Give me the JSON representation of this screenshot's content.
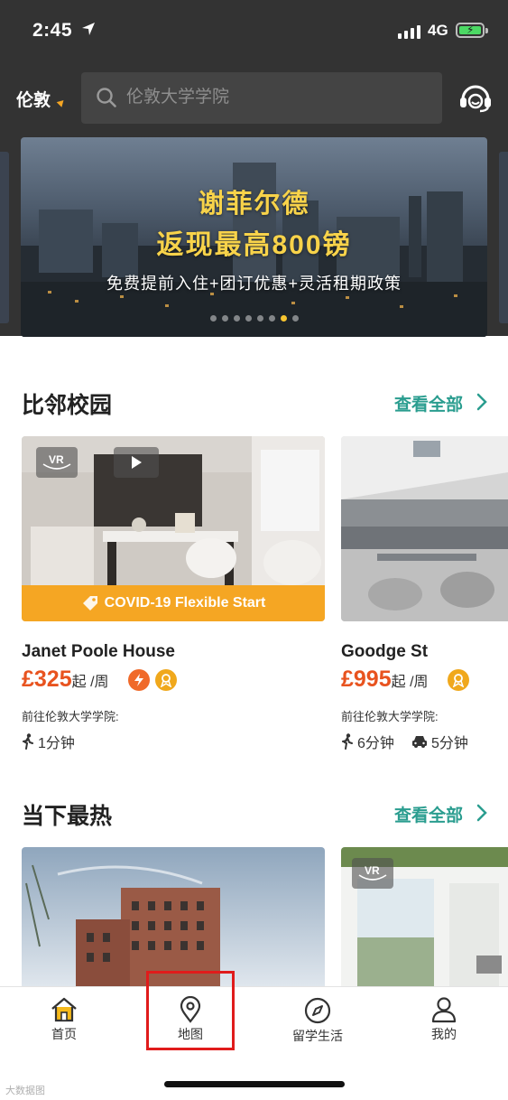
{
  "status_bar": {
    "time": "2:45",
    "network": "4G",
    "battery_level": 0.85
  },
  "header": {
    "city": "伦敦",
    "search": {
      "placeholder": "伦敦大学学院",
      "value": ""
    },
    "support_icon": "headset-icon"
  },
  "banner": {
    "title_line1": "谢菲尔德",
    "title_line2": "返现最高800镑",
    "subtitle": "免费提前入住+团订优惠+灵活租期政策",
    "page_count": 8,
    "active_page": 6
  },
  "nearby_section": {
    "title": "比邻校园",
    "see_all": "查看全部",
    "cards": [
      {
        "name": "Janet Poole House",
        "price": "£325",
        "price_suffix": "起 /周",
        "banner": "COVID-19 Flexible Start",
        "tags": [
          "VR",
          "video"
        ],
        "badges": [
          "flash-icon",
          "award-icon"
        ],
        "destination": "前往伦敦大学学院:",
        "walk": "1分钟"
      },
      {
        "name": "Goodge St",
        "price": "£995",
        "price_suffix": "起 /周",
        "badges": [
          "award-icon"
        ],
        "destination": "前往伦敦大学学院:",
        "walk": "6分钟",
        "drive": "5分钟"
      }
    ]
  },
  "hot_section": {
    "title": "当下最热",
    "see_all": "查看全部",
    "cards": [
      {
        "tags": []
      },
      {
        "tags": [
          "VR"
        ]
      }
    ]
  },
  "tab_bar": {
    "tabs": [
      {
        "label": "首页",
        "icon": "home-icon",
        "active": true
      },
      {
        "label": "地图",
        "icon": "map-pin-icon",
        "active": false,
        "highlighted": true
      },
      {
        "label": "留学生活",
        "icon": "compass-icon",
        "active": false
      },
      {
        "label": "我的",
        "icon": "user-icon",
        "active": false
      }
    ]
  },
  "watermark": "大数据图",
  "colors": {
    "accent": "#2a9d8f",
    "price": "#e8531f",
    "banner_yellow": "#f8d34a",
    "covid_orange": "#f5a623",
    "highlight_red": "#e01b1b"
  }
}
